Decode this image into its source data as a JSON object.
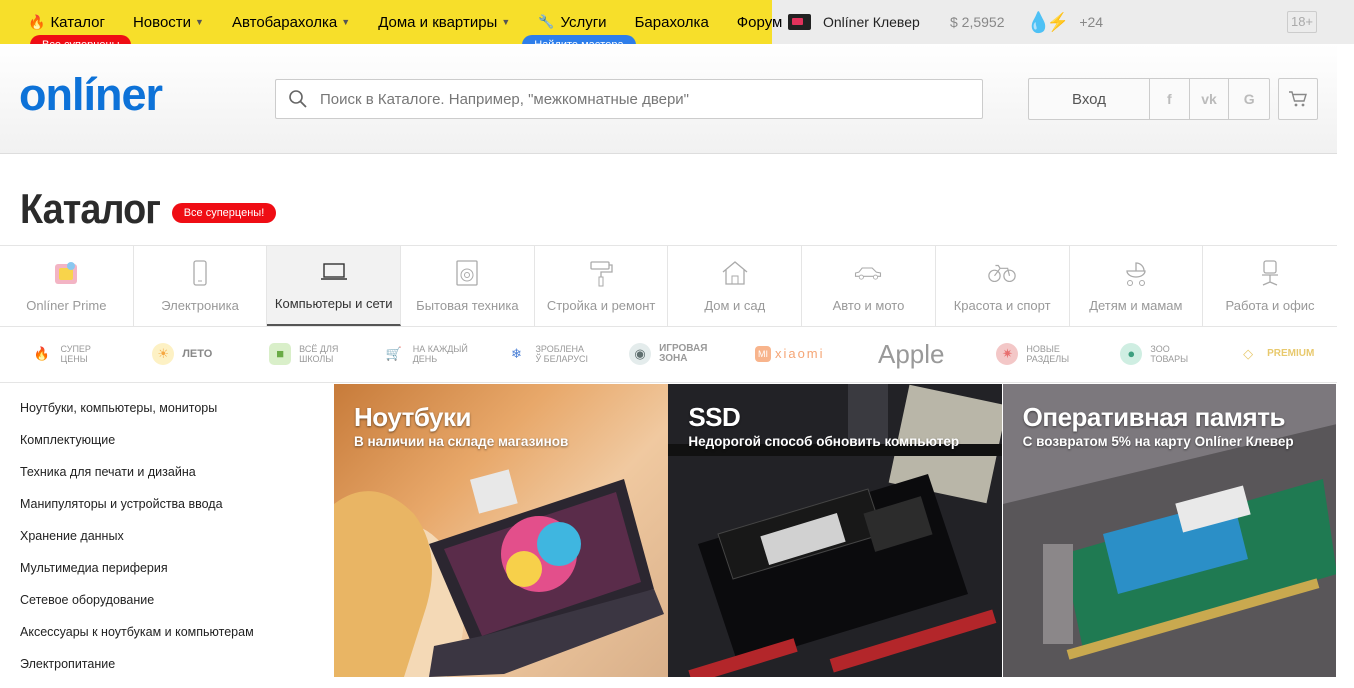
{
  "topnav": {
    "items": [
      {
        "label": "Каталог",
        "badge": "Все суперцены"
      },
      {
        "label": "Новости"
      },
      {
        "label": "Автобарахолка"
      },
      {
        "label": "Дома и квартиры"
      },
      {
        "label": "Услуги",
        "badge": "Найдите мастера"
      },
      {
        "label": "Барахолка"
      },
      {
        "label": "Форум"
      }
    ],
    "klever": "Onlíner Клевер",
    "rate": "$ 2,5952",
    "temperature": "+24",
    "age": "18+"
  },
  "header": {
    "logo": "onlíner",
    "search_placeholder": "Поиск в Каталоге. Например, \"межкомнатные двери\"",
    "login": "Вход",
    "social": [
      "f",
      "vk",
      "G"
    ]
  },
  "page": {
    "title": "Каталог",
    "title_badge": "Все суперцены!"
  },
  "categories": [
    {
      "label": "Onlíner Prime",
      "icon": "prime-icon"
    },
    {
      "label": "Электроника",
      "icon": "phone-icon"
    },
    {
      "label": "Компьютеры и сети",
      "icon": "laptop-icon",
      "active": true
    },
    {
      "label": "Бытовая техника",
      "icon": "washer-icon"
    },
    {
      "label": "Стройка и ремонт",
      "icon": "roller-icon"
    },
    {
      "label": "Дом и сад",
      "icon": "house-icon"
    },
    {
      "label": "Авто и мото",
      "icon": "car-icon"
    },
    {
      "label": "Красота и спорт",
      "icon": "bicycle-icon"
    },
    {
      "label": "Детям и мамам",
      "icon": "stroller-icon"
    },
    {
      "label": "Работа и офис",
      "icon": "chair-icon"
    }
  ],
  "promos": [
    {
      "line1": "Супер",
      "line2": "цены",
      "icon": "fire-icon",
      "color": "#f28a5c"
    },
    {
      "line1": "Лето",
      "line2": "",
      "icon": "summer-icon",
      "color": "#f5c842"
    },
    {
      "line1": "Всё для",
      "line2": "школы",
      "icon": "backpack-icon",
      "color": "#8fcb6b"
    },
    {
      "line1": "На каждый",
      "line2": "день",
      "icon": "cart-icon",
      "color": "#4aa3e0"
    },
    {
      "line1": "Зроблена",
      "line2": "ў Беларусі",
      "icon": "snowflake-icon",
      "color": "#4a7fd6"
    },
    {
      "line1": "Игровая",
      "line2": "зона",
      "icon": "gamer-icon",
      "color": "#7b8c8c"
    },
    {
      "line1": "xiaomi",
      "line2": "",
      "icon": "xiaomi-icon",
      "color": "#f5a575"
    },
    {
      "line1": "Apple",
      "line2": "",
      "icon": "apple-icon",
      "color": "#999999"
    },
    {
      "line1": "Новые",
      "line2": "разделы",
      "icon": "new-icon",
      "color": "#e86f6f"
    },
    {
      "line1": "Зоо",
      "line2": "товары",
      "icon": "pet-food-icon",
      "color": "#6fbfa8"
    },
    {
      "line1": "Premium",
      "line2": "",
      "icon": "diamond-icon",
      "color": "#e8c96d"
    }
  ],
  "sidebar": [
    "Ноутбуки, компьютеры, мониторы",
    "Комплектующие",
    "Техника для печати и дизайна",
    "Манипуляторы и устройства ввода",
    "Хранение данных",
    "Мультимедиа периферия",
    "Сетевое оборудование",
    "Аксессуары к ноутбукам и компьютерам",
    "Электропитание"
  ],
  "banners": [
    {
      "title": "Ноутбуки",
      "subtitle": "В наличии на складе магазинов"
    },
    {
      "title": "SSD",
      "subtitle": "Недорогой способ обновить компьютер"
    },
    {
      "title": "Оперативная память",
      "subtitle": "С возвратом 5% на карту Onlíner Клевер"
    }
  ],
  "colors": {
    "topbar_yellow": "#f7df2a",
    "brand_blue": "#0d72d8",
    "badge_red": "#ef0d14",
    "badge_blue": "#2e7eea"
  }
}
